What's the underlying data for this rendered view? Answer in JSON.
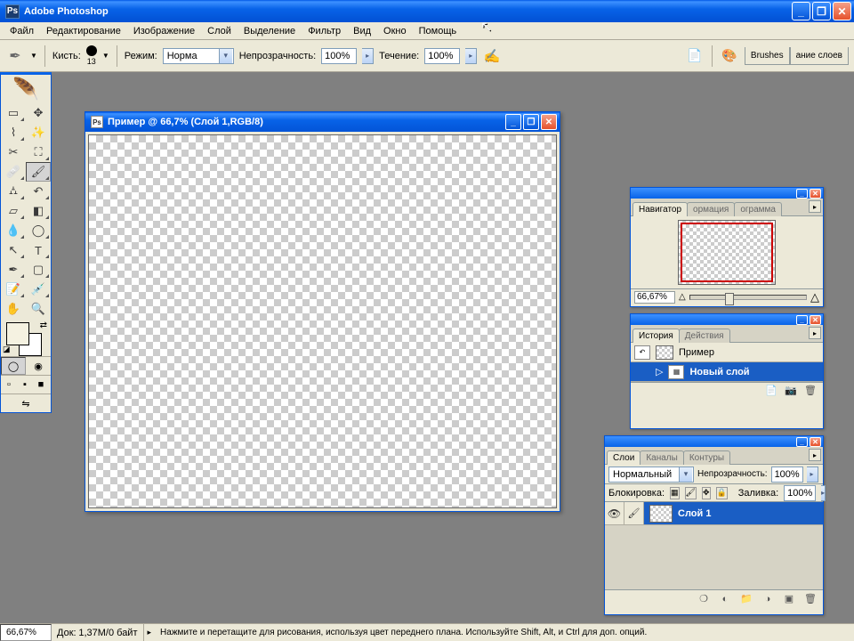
{
  "app": {
    "title": "Adobe Photoshop"
  },
  "menu": [
    "Файл",
    "Редактирование",
    "Изображение",
    "Слой",
    "Выделение",
    "Фильтр",
    "Вид",
    "Окно",
    "Помощь"
  ],
  "options": {
    "brush_label": "Кисть:",
    "brush_size": "13",
    "mode_label": "Режим:",
    "mode_value": "Норма",
    "opacity_label": "Непрозрачность:",
    "opacity_value": "100%",
    "flow_label": "Течение:",
    "flow_value": "100%",
    "palette_tabs": [
      "Brushes",
      "ание слоев"
    ]
  },
  "document": {
    "title": "Пример @ 66,7% (Слой 1,RGB/8)"
  },
  "navigator": {
    "tabs": [
      "Навигатор",
      "ормация",
      "ограмма"
    ],
    "zoom": "66,67%"
  },
  "history": {
    "tabs": [
      "История",
      "Действия"
    ],
    "snapshot": "Пример",
    "entries": [
      "Новый слой"
    ]
  },
  "layers": {
    "tabs": [
      "Слои",
      "Каналы",
      "Контуры"
    ],
    "blend_mode": "Нормальный",
    "opacity_label": "Непрозрачность:",
    "opacity_value": "100%",
    "lock_label": "Блокировка:",
    "fill_label": "Заливка:",
    "fill_value": "100%",
    "items": [
      {
        "name": "Слой 1"
      }
    ]
  },
  "status": {
    "zoom": "66,67%",
    "doc_size_label": "Док:",
    "doc_size": "1,37M/0 байт",
    "hint": "Нажмите и перетащите для рисования, используя цвет переднего плана. Используйте Shift, Alt, и Ctrl для доп. опций."
  }
}
